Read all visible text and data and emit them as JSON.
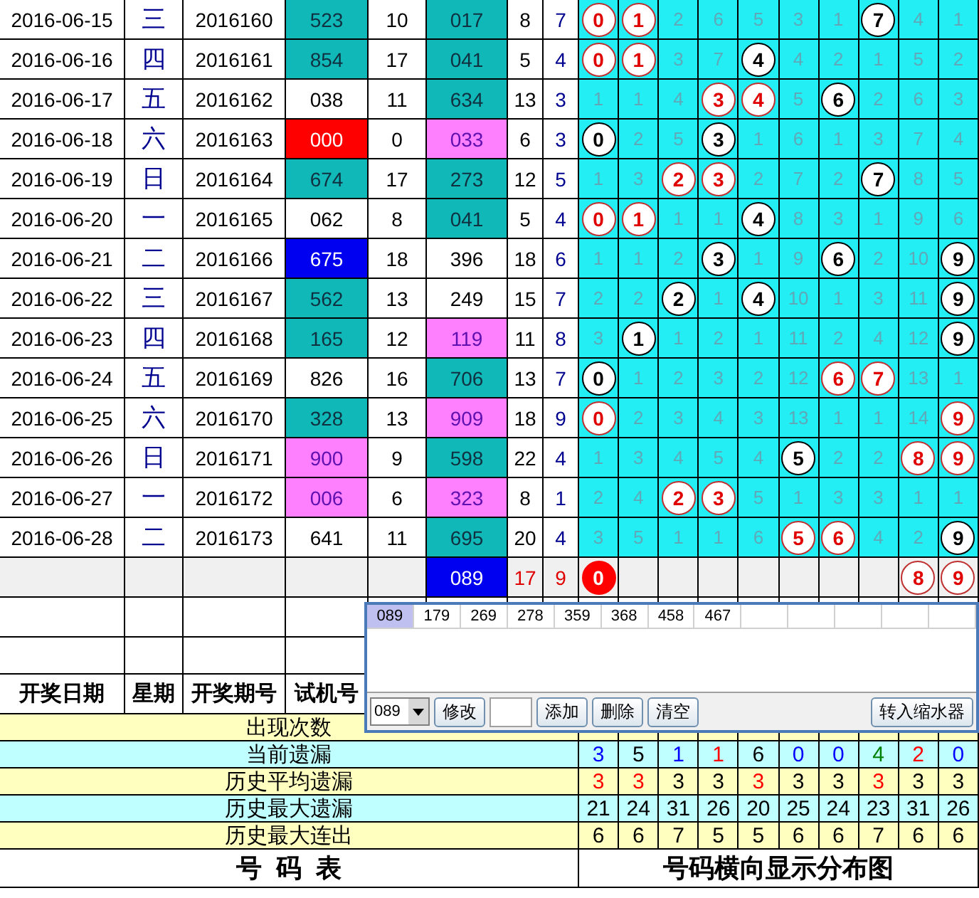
{
  "rows": [
    {
      "date": "2016-06-15",
      "weekday": "三",
      "issue": "2016160",
      "test_number": {
        "value": "523",
        "kind": "teal"
      },
      "column_5": "10",
      "column_6": {
        "value": "017",
        "kind": "teal"
      },
      "column_7": "8",
      "column_8": "7",
      "cells": [
        {
          "value": "0",
          "kind": "red"
        },
        {
          "value": "1",
          "kind": "red"
        },
        {
          "value": "2",
          "kind": "plain"
        },
        {
          "value": "6",
          "kind": "plain"
        },
        {
          "value": "5",
          "kind": "plain"
        },
        {
          "value": "3",
          "kind": "plain"
        },
        {
          "value": "1",
          "kind": "plain"
        },
        {
          "value": "7",
          "kind": "black"
        },
        {
          "value": "4",
          "kind": "plain"
        },
        {
          "value": "1",
          "kind": "plain"
        }
      ]
    },
    {
      "date": "2016-06-16",
      "weekday": "四",
      "issue": "2016161",
      "test_number": {
        "value": "854",
        "kind": "teal"
      },
      "column_5": "17",
      "column_6": {
        "value": "041",
        "kind": "teal"
      },
      "column_7": "5",
      "column_8": "4",
      "cells": [
        {
          "value": "0",
          "kind": "red"
        },
        {
          "value": "1",
          "kind": "red"
        },
        {
          "value": "3",
          "kind": "plain"
        },
        {
          "value": "7",
          "kind": "plain"
        },
        {
          "value": "4",
          "kind": "black"
        },
        {
          "value": "4",
          "kind": "plain"
        },
        {
          "value": "2",
          "kind": "plain"
        },
        {
          "value": "1",
          "kind": "plain"
        },
        {
          "value": "5",
          "kind": "plain"
        },
        {
          "value": "2",
          "kind": "plain"
        }
      ]
    },
    {
      "date": "2016-06-17",
      "weekday": "五",
      "issue": "2016162",
      "test_number": {
        "value": "038",
        "kind": "plain"
      },
      "column_5": "11",
      "column_6": {
        "value": "634",
        "kind": "teal"
      },
      "column_7": "13",
      "column_8": "3",
      "cells": [
        {
          "value": "1",
          "kind": "plain"
        },
        {
          "value": "1",
          "kind": "plain"
        },
        {
          "value": "4",
          "kind": "plain"
        },
        {
          "value": "3",
          "kind": "red"
        },
        {
          "value": "4",
          "kind": "red"
        },
        {
          "value": "5",
          "kind": "plain"
        },
        {
          "value": "6",
          "kind": "black"
        },
        {
          "value": "2",
          "kind": "plain"
        },
        {
          "value": "6",
          "kind": "plain"
        },
        {
          "value": "3",
          "kind": "plain"
        }
      ]
    },
    {
      "date": "2016-06-18",
      "weekday": "六",
      "issue": "2016163",
      "test_number": {
        "value": "000",
        "kind": "red"
      },
      "column_5": "0",
      "column_6": {
        "value": "033",
        "kind": "pink"
      },
      "column_7": "6",
      "column_8": "3",
      "cells": [
        {
          "value": "0",
          "kind": "black"
        },
        {
          "value": "2",
          "kind": "plain"
        },
        {
          "value": "5",
          "kind": "plain"
        },
        {
          "value": "3",
          "kind": "black"
        },
        {
          "value": "1",
          "kind": "plain"
        },
        {
          "value": "6",
          "kind": "plain"
        },
        {
          "value": "1",
          "kind": "plain"
        },
        {
          "value": "3",
          "kind": "plain"
        },
        {
          "value": "7",
          "kind": "plain"
        },
        {
          "value": "4",
          "kind": "plain"
        }
      ]
    },
    {
      "date": "2016-06-19",
      "weekday": "日",
      "issue": "2016164",
      "test_number": {
        "value": "674",
        "kind": "teal"
      },
      "column_5": "17",
      "column_6": {
        "value": "273",
        "kind": "teal"
      },
      "column_7": "12",
      "column_8": "5",
      "cells": [
        {
          "value": "1",
          "kind": "plain"
        },
        {
          "value": "3",
          "kind": "plain"
        },
        {
          "value": "2",
          "kind": "red"
        },
        {
          "value": "3",
          "kind": "red"
        },
        {
          "value": "2",
          "kind": "plain"
        },
        {
          "value": "7",
          "kind": "plain"
        },
        {
          "value": "2",
          "kind": "plain"
        },
        {
          "value": "7",
          "kind": "black"
        },
        {
          "value": "8",
          "kind": "plain"
        },
        {
          "value": "5",
          "kind": "plain"
        }
      ]
    },
    {
      "date": "2016-06-20",
      "weekday": "一",
      "issue": "2016165",
      "test_number": {
        "value": "062",
        "kind": "plain"
      },
      "column_5": "8",
      "column_6": {
        "value": "041",
        "kind": "teal"
      },
      "column_7": "5",
      "column_8": "4",
      "cells": [
        {
          "value": "0",
          "kind": "red"
        },
        {
          "value": "1",
          "kind": "red"
        },
        {
          "value": "1",
          "kind": "plain"
        },
        {
          "value": "1",
          "kind": "plain"
        },
        {
          "value": "4",
          "kind": "black"
        },
        {
          "value": "8",
          "kind": "plain"
        },
        {
          "value": "3",
          "kind": "plain"
        },
        {
          "value": "1",
          "kind": "plain"
        },
        {
          "value": "9",
          "kind": "plain"
        },
        {
          "value": "6",
          "kind": "plain"
        }
      ]
    },
    {
      "date": "2016-06-21",
      "weekday": "二",
      "issue": "2016166",
      "test_number": {
        "value": "675",
        "kind": "blue"
      },
      "column_5": "18",
      "column_6": {
        "value": "396",
        "kind": "plain"
      },
      "column_7": "18",
      "column_8": "6",
      "cells": [
        {
          "value": "1",
          "kind": "plain"
        },
        {
          "value": "1",
          "kind": "plain"
        },
        {
          "value": "2",
          "kind": "plain"
        },
        {
          "value": "3",
          "kind": "black"
        },
        {
          "value": "1",
          "kind": "plain"
        },
        {
          "value": "9",
          "kind": "plain"
        },
        {
          "value": "6",
          "kind": "black"
        },
        {
          "value": "2",
          "kind": "plain"
        },
        {
          "value": "10",
          "kind": "plain"
        },
        {
          "value": "9",
          "kind": "black"
        }
      ]
    },
    {
      "date": "2016-06-22",
      "weekday": "三",
      "issue": "2016167",
      "test_number": {
        "value": "562",
        "kind": "teal"
      },
      "column_5": "13",
      "column_6": {
        "value": "249",
        "kind": "plain"
      },
      "column_7": "15",
      "column_8": "7",
      "cells": [
        {
          "value": "2",
          "kind": "plain"
        },
        {
          "value": "2",
          "kind": "plain"
        },
        {
          "value": "2",
          "kind": "black"
        },
        {
          "value": "1",
          "kind": "plain"
        },
        {
          "value": "4",
          "kind": "black"
        },
        {
          "value": "10",
          "kind": "plain"
        },
        {
          "value": "1",
          "kind": "plain"
        },
        {
          "value": "3",
          "kind": "plain"
        },
        {
          "value": "11",
          "kind": "plain"
        },
        {
          "value": "9",
          "kind": "black"
        }
      ]
    },
    {
      "date": "2016-06-23",
      "weekday": "四",
      "issue": "2016168",
      "test_number": {
        "value": "165",
        "kind": "teal"
      },
      "column_5": "12",
      "column_6": {
        "value": "119",
        "kind": "pink"
      },
      "column_7": "11",
      "column_8": "8",
      "cells": [
        {
          "value": "3",
          "kind": "plain"
        },
        {
          "value": "1",
          "kind": "black"
        },
        {
          "value": "1",
          "kind": "plain"
        },
        {
          "value": "2",
          "kind": "plain"
        },
        {
          "value": "1",
          "kind": "plain"
        },
        {
          "value": "11",
          "kind": "plain"
        },
        {
          "value": "2",
          "kind": "plain"
        },
        {
          "value": "4",
          "kind": "plain"
        },
        {
          "value": "12",
          "kind": "plain"
        },
        {
          "value": "9",
          "kind": "black"
        }
      ]
    },
    {
      "date": "2016-06-24",
      "weekday": "五",
      "issue": "2016169",
      "test_number": {
        "value": "826",
        "kind": "plain"
      },
      "column_5": "16",
      "column_6": {
        "value": "706",
        "kind": "teal"
      },
      "column_7": "13",
      "column_8": "7",
      "cells": [
        {
          "value": "0",
          "kind": "black"
        },
        {
          "value": "1",
          "kind": "plain"
        },
        {
          "value": "2",
          "kind": "plain"
        },
        {
          "value": "3",
          "kind": "plain"
        },
        {
          "value": "2",
          "kind": "plain"
        },
        {
          "value": "12",
          "kind": "plain"
        },
        {
          "value": "6",
          "kind": "red"
        },
        {
          "value": "7",
          "kind": "red"
        },
        {
          "value": "13",
          "kind": "plain"
        },
        {
          "value": "1",
          "kind": "plain"
        }
      ]
    },
    {
      "date": "2016-06-25",
      "weekday": "六",
      "issue": "2016170",
      "test_number": {
        "value": "328",
        "kind": "teal"
      },
      "column_5": "13",
      "column_6": {
        "value": "909",
        "kind": "pink"
      },
      "column_7": "18",
      "column_8": "9",
      "cells": [
        {
          "value": "0",
          "kind": "red"
        },
        {
          "value": "2",
          "kind": "plain"
        },
        {
          "value": "3",
          "kind": "plain"
        },
        {
          "value": "4",
          "kind": "plain"
        },
        {
          "value": "3",
          "kind": "plain"
        },
        {
          "value": "13",
          "kind": "plain"
        },
        {
          "value": "1",
          "kind": "plain"
        },
        {
          "value": "1",
          "kind": "plain"
        },
        {
          "value": "14",
          "kind": "plain"
        },
        {
          "value": "9",
          "kind": "red"
        }
      ]
    },
    {
      "date": "2016-06-26",
      "weekday": "日",
      "issue": "2016171",
      "test_number": {
        "value": "900",
        "kind": "pink"
      },
      "column_5": "9",
      "column_6": {
        "value": "598",
        "kind": "teal"
      },
      "column_7": "22",
      "column_8": "4",
      "cells": [
        {
          "value": "1",
          "kind": "plain"
        },
        {
          "value": "3",
          "kind": "plain"
        },
        {
          "value": "4",
          "kind": "plain"
        },
        {
          "value": "5",
          "kind": "plain"
        },
        {
          "value": "4",
          "kind": "plain"
        },
        {
          "value": "5",
          "kind": "black"
        },
        {
          "value": "2",
          "kind": "plain"
        },
        {
          "value": "2",
          "kind": "plain"
        },
        {
          "value": "8",
          "kind": "red"
        },
        {
          "value": "9",
          "kind": "red"
        }
      ]
    },
    {
      "date": "2016-06-27",
      "weekday": "一",
      "issue": "2016172",
      "test_number": {
        "value": "006",
        "kind": "pink"
      },
      "column_5": "6",
      "column_6": {
        "value": "323",
        "kind": "pink"
      },
      "column_7": "8",
      "column_8": "1",
      "cells": [
        {
          "value": "2",
          "kind": "plain"
        },
        {
          "value": "4",
          "kind": "plain"
        },
        {
          "value": "2",
          "kind": "red"
        },
        {
          "value": "3",
          "kind": "red"
        },
        {
          "value": "5",
          "kind": "plain"
        },
        {
          "value": "1",
          "kind": "plain"
        },
        {
          "value": "3",
          "kind": "plain"
        },
        {
          "value": "3",
          "kind": "plain"
        },
        {
          "value": "1",
          "kind": "plain"
        },
        {
          "value": "1",
          "kind": "plain"
        }
      ]
    },
    {
      "date": "2016-06-28",
      "weekday": "二",
      "issue": "2016173",
      "test_number": {
        "value": "641",
        "kind": "plain"
      },
      "column_5": "11",
      "column_6": {
        "value": "695",
        "kind": "teal"
      },
      "column_7": "20",
      "column_8": "4",
      "cells": [
        {
          "value": "3",
          "kind": "plain"
        },
        {
          "value": "5",
          "kind": "plain"
        },
        {
          "value": "1",
          "kind": "plain"
        },
        {
          "value": "1",
          "kind": "plain"
        },
        {
          "value": "6",
          "kind": "plain"
        },
        {
          "value": "5",
          "kind": "red"
        },
        {
          "value": "6",
          "kind": "red"
        },
        {
          "value": "4",
          "kind": "plain"
        },
        {
          "value": "2",
          "kind": "plain"
        },
        {
          "value": "9",
          "kind": "black"
        }
      ]
    }
  ],
  "summary_row": {
    "column_6": {
      "value": "089",
      "kind": "blue"
    },
    "column_7": "17",
    "column_8": "9",
    "cells": [
      {
        "value": "0",
        "kind": "solid"
      },
      {
        "kind": "empty"
      },
      {
        "kind": "empty"
      },
      {
        "kind": "empty"
      },
      {
        "kind": "empty"
      },
      {
        "kind": "empty"
      },
      {
        "kind": "empty"
      },
      {
        "kind": "empty"
      },
      {
        "value": "8",
        "kind": "red"
      },
      {
        "value": "9",
        "kind": "red"
      }
    ]
  },
  "header": [
    "开奖日期",
    "星期",
    "开奖期号",
    "试机号"
  ],
  "stats": [
    {
      "label": "出现次数"
    },
    {
      "label": "当前遗漏",
      "values": [
        {
          "value": "3",
          "color": "#0000ff"
        },
        {
          "value": "5",
          "color": "#000000"
        },
        {
          "value": "1",
          "color": "#0000ff"
        },
        {
          "value": "1",
          "color": "#ff0000"
        },
        {
          "value": "6",
          "color": "#000000"
        },
        {
          "value": "0",
          "color": "#0000ff"
        },
        {
          "value": "0",
          "color": "#0000ff"
        },
        {
          "value": "4",
          "color": "#008000"
        },
        {
          "value": "2",
          "color": "#ff0000"
        },
        {
          "value": "0",
          "color": "#0000ff"
        }
      ]
    },
    {
      "label": "历史平均遗漏",
      "values": [
        {
          "value": "3",
          "color": "#ff0000"
        },
        {
          "value": "3",
          "color": "#ff0000"
        },
        {
          "value": "3",
          "color": "#000000"
        },
        {
          "value": "3",
          "color": "#000000"
        },
        {
          "value": "3",
          "color": "#ff0000"
        },
        {
          "value": "3",
          "color": "#000000"
        },
        {
          "value": "3",
          "color": "#000000"
        },
        {
          "value": "3",
          "color": "#ff0000"
        },
        {
          "value": "3",
          "color": "#000000"
        },
        {
          "value": "3",
          "color": "#000000"
        }
      ]
    },
    {
      "label": "历史最大遗漏",
      "values": [
        {
          "value": "21",
          "color": "#000000"
        },
        {
          "value": "24",
          "color": "#000000"
        },
        {
          "value": "31",
          "color": "#000000"
        },
        {
          "value": "26",
          "color": "#000000"
        },
        {
          "value": "20",
          "color": "#000000"
        },
        {
          "value": "25",
          "color": "#000000"
        },
        {
          "value": "24",
          "color": "#000000"
        },
        {
          "value": "23",
          "color": "#000000"
        },
        {
          "value": "31",
          "color": "#000000"
        },
        {
          "value": "26",
          "color": "#000000"
        }
      ]
    },
    {
      "label": "历史最大连出",
      "values": [
        {
          "value": "6",
          "color": "#000000"
        },
        {
          "value": "6",
          "color": "#000000"
        },
        {
          "value": "7",
          "color": "#000000"
        },
        {
          "value": "5",
          "color": "#000000"
        },
        {
          "value": "5",
          "color": "#000000"
        },
        {
          "value": "6",
          "color": "#000000"
        },
        {
          "value": "6",
          "color": "#000000"
        },
        {
          "value": "7",
          "color": "#000000"
        },
        {
          "value": "6",
          "color": "#000000"
        },
        {
          "value": "6",
          "color": "#000000"
        }
      ]
    }
  ],
  "footer": [
    "号  码  表",
    "号码横向显示分布图"
  ],
  "popup": {
    "chips": [
      {
        "label": "089",
        "selected": true
      },
      {
        "label": "179",
        "selected": false
      },
      {
        "label": "269",
        "selected": false
      },
      {
        "label": "278",
        "selected": false
      },
      {
        "label": "359",
        "selected": false
      },
      {
        "label": "368",
        "selected": false
      },
      {
        "label": "458",
        "selected": false
      },
      {
        "label": "467",
        "selected": false
      }
    ],
    "select": "089",
    "buttons": [
      "修改",
      "添加",
      "删除",
      "清空"
    ],
    "right_button": "转入缩水器"
  }
}
